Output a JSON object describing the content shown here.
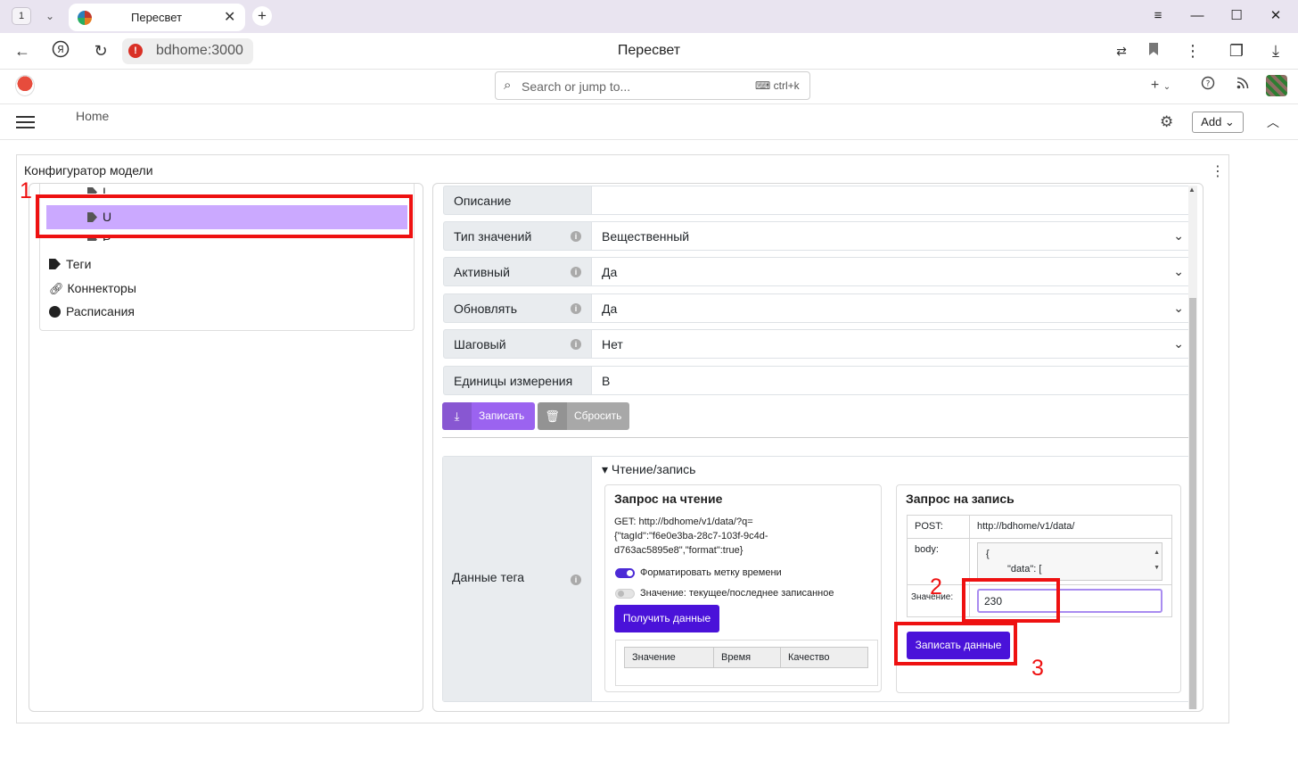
{
  "browser": {
    "tab_count": "1",
    "tab_title": "Пересвет",
    "url": "bdhome:3000",
    "page_title": "Пересвет"
  },
  "app": {
    "search_placeholder": "Search or jump to...",
    "search_shortcut": "ctrl+k",
    "breadcrumb": "Home",
    "add_label": "Add"
  },
  "panel": {
    "title": "Конфигуратор модели"
  },
  "tree": {
    "items": [
      {
        "label": "I"
      },
      {
        "label": "U"
      },
      {
        "label": "P"
      },
      {
        "label": "Теги"
      },
      {
        "label": "Коннекторы"
      },
      {
        "label": "Расписания"
      }
    ]
  },
  "form": {
    "fields": [
      {
        "label": "Описание",
        "value": ""
      },
      {
        "label": "Тип значений",
        "value": "Вещественный"
      },
      {
        "label": "Активный",
        "value": "Да"
      },
      {
        "label": "Обновлять",
        "value": "Да"
      },
      {
        "label": "Шаговый",
        "value": "Нет"
      },
      {
        "label": "Единицы измерения",
        "value": "В"
      }
    ],
    "save_label": "Записать",
    "reset_label": "Сбросить"
  },
  "tag_data": {
    "label": "Данные тега",
    "section_title": "Чтение/запись",
    "read": {
      "title": "Запрос на чтение",
      "get_line1": "GET:  http://bdhome/v1/data/?q=",
      "get_line2": "{\"tagId\":\"f6e0e3ba-28c7-103f-9c4d-",
      "get_line3": "d763ac5895e8\",\"format\":true}",
      "toggle_format_label": "Форматировать метку времени",
      "toggle_value_label": "Значение: текущее/последнее записанное",
      "fetch_button": "Получить данные",
      "columns": [
        "Значение",
        "Время",
        "Качество"
      ]
    },
    "write": {
      "title": "Запрос на запись",
      "post_label": "POST:",
      "post_url": "http://bdhome/v1/data/",
      "body_label": "body:",
      "body_line1": "{",
      "body_line2": "\"data\": [",
      "value_label": "Значение:",
      "value": "230",
      "write_button": "Записать данные"
    }
  },
  "annotations": [
    "1",
    "2",
    "3"
  ]
}
